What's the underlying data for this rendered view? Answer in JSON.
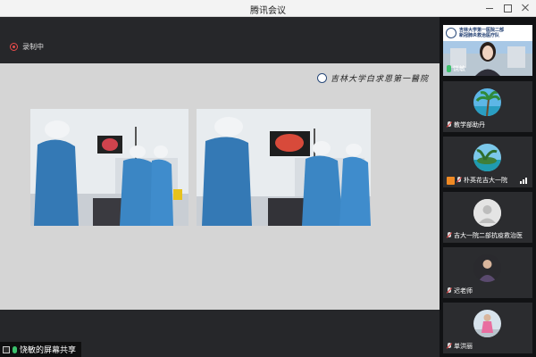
{
  "window": {
    "title": "腾讯会议"
  },
  "recording": {
    "label": "录制中",
    "color": "#e84b4b"
  },
  "slide": {
    "logo_text": "吉林大学白求恩第一醫院"
  },
  "share_status": {
    "label": "饶敏的屏幕共享"
  },
  "participants": [
    {
      "name": "饶敏",
      "mic": "on",
      "video": true,
      "banner_line1": "吉林大学第一医院二部",
      "banner_line2": "新冠肺炎救治医疗队"
    },
    {
      "name": "教学部助丹",
      "mic": "muted",
      "avatar": "palm-tree"
    },
    {
      "name": "朴英花吉大一院",
      "mic": "muted",
      "avatar": "tropical-island",
      "has_user_badge": true,
      "signal_bars": 3
    },
    {
      "name": "吉大一院二部抗疫救治医",
      "mic": "muted",
      "avatar": "default-user"
    },
    {
      "name": "迟老师",
      "mic": "muted",
      "avatar": "person-photo"
    },
    {
      "name": "单洪丽",
      "mic": "muted",
      "avatar": "person-photo-outdoor"
    }
  ],
  "colors": {
    "panel_bg": "#111214",
    "tile_bg": "#2b2c2f",
    "mic_on": "#3bc16c",
    "mic_muted": "#e04040",
    "user_badge": "#f08a24"
  }
}
